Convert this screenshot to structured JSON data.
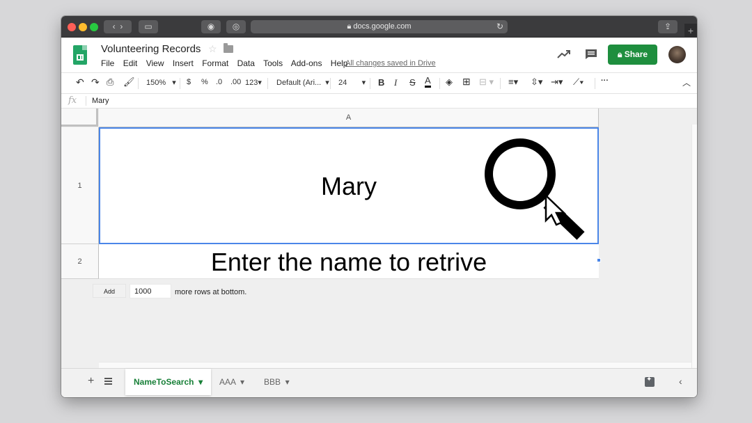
{
  "browser": {
    "url": "docs.google.com"
  },
  "doc": {
    "title": "Volunteering Records",
    "menu": [
      "File",
      "Edit",
      "View",
      "Insert",
      "Format",
      "Data",
      "Tools",
      "Add-ons",
      "Help"
    ],
    "saved_status": "All changes saved in Drive",
    "share_label": "Share"
  },
  "toolbar": {
    "zoom": "150%",
    "currency": "$",
    "percent": "%",
    "decimal_dec": ".0",
    "decimal_inc": ".00",
    "more_formats": "123",
    "font": "Default (Ari...",
    "font_size": "24",
    "bold": "B",
    "italic": "I",
    "strike": "S",
    "text_color": "A",
    "more": "···"
  },
  "formula": {
    "fx": "fx",
    "value": "Mary"
  },
  "grid": {
    "column": "A",
    "rows": [
      {
        "number": "1",
        "value": "Mary"
      },
      {
        "number": "2",
        "value": "Enter the name to retrive"
      }
    ],
    "add_button": "Add",
    "add_count": "1000",
    "add_suffix": "more rows at bottom."
  },
  "tabs": [
    {
      "label": "NameToSearch",
      "active": true
    },
    {
      "label": "AAA",
      "active": false
    },
    {
      "label": "BBB",
      "active": false
    }
  ],
  "colors": {
    "share": "#1e8e3e",
    "selection": "#4a86e8",
    "active_tab": "#188038"
  }
}
